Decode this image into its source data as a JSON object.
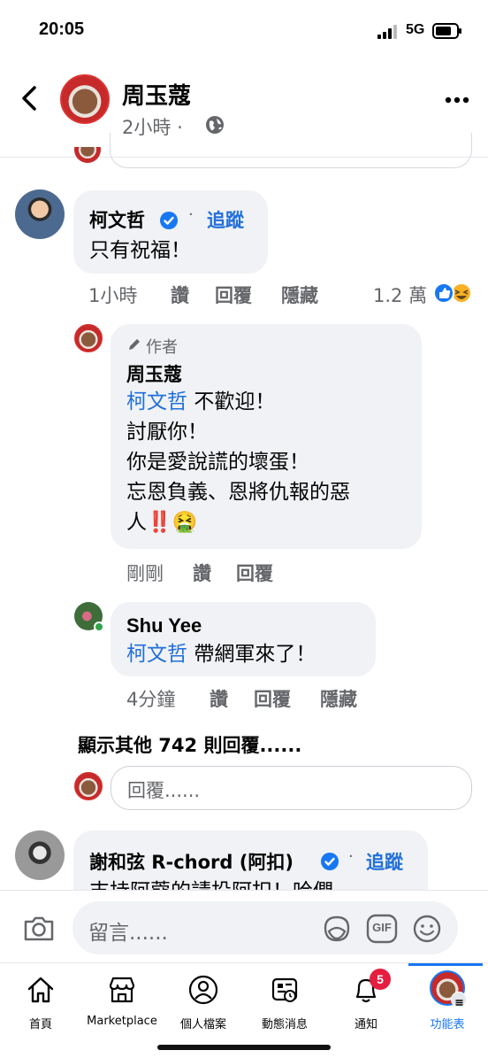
{
  "status_bar": {
    "time": "20:05",
    "network": "5G"
  },
  "header": {
    "name": "周玉蔻",
    "time": "2小時",
    "dot": "·"
  },
  "comments": [
    {
      "author": "柯文哲",
      "verified": true,
      "follow_label": "追蹤",
      "dot": "·",
      "text": "只有祝福！",
      "meta": {
        "time": "1小時",
        "like": "讚",
        "reply": "回覆",
        "hide": "隱藏",
        "reaction_count": "1.2 萬"
      }
    }
  ],
  "replies": [
    {
      "author_tag": "作者",
      "author": "周玉蔻",
      "mention": "柯文哲",
      "lines": [
        "不歡迎！",
        "討厭你！",
        "你是愛說謊的壞蛋！",
        "忘恩負義、恩將仇報的惡",
        "人"
      ],
      "emoji_tail": "‼️🤮",
      "meta": {
        "time": "剛剛",
        "like": "讚",
        "reply": "回覆"
      }
    },
    {
      "author": "Shu Yee",
      "mention": "柯文哲",
      "text": "帶網軍來了！",
      "meta": {
        "time": "4分鐘",
        "like": "讚",
        "reply": "回覆",
        "hide": "隱藏"
      }
    }
  ],
  "more_replies": "顯示其他 742 則回覆......",
  "reply_placeholder": "回覆......",
  "next_comment": {
    "author": "謝和弦 R-chord (阿扣)",
    "follow_label": "追蹤",
    "dot": "·",
    "text_partial": "支持阿蔻的請投阿扣！哈們"
  },
  "composer": {
    "placeholder": "留言......",
    "gif_label": "GIF"
  },
  "tabs": [
    {
      "label": "首頁",
      "icon": "home-icon"
    },
    {
      "label": "Marketplace",
      "icon": "marketplace-icon"
    },
    {
      "label": "個人檔案",
      "icon": "profile-icon"
    },
    {
      "label": "動態消息",
      "icon": "news-feed-icon"
    },
    {
      "label": "通知",
      "icon": "bell-icon",
      "badge": "5"
    },
    {
      "label": "功能表",
      "icon": "menu-avatar-icon",
      "active": true
    }
  ],
  "colors": {
    "link": "#216fdb",
    "accent": "#1877f2",
    "bubble": "#f0f2f5",
    "badge": "#e41e3f"
  }
}
